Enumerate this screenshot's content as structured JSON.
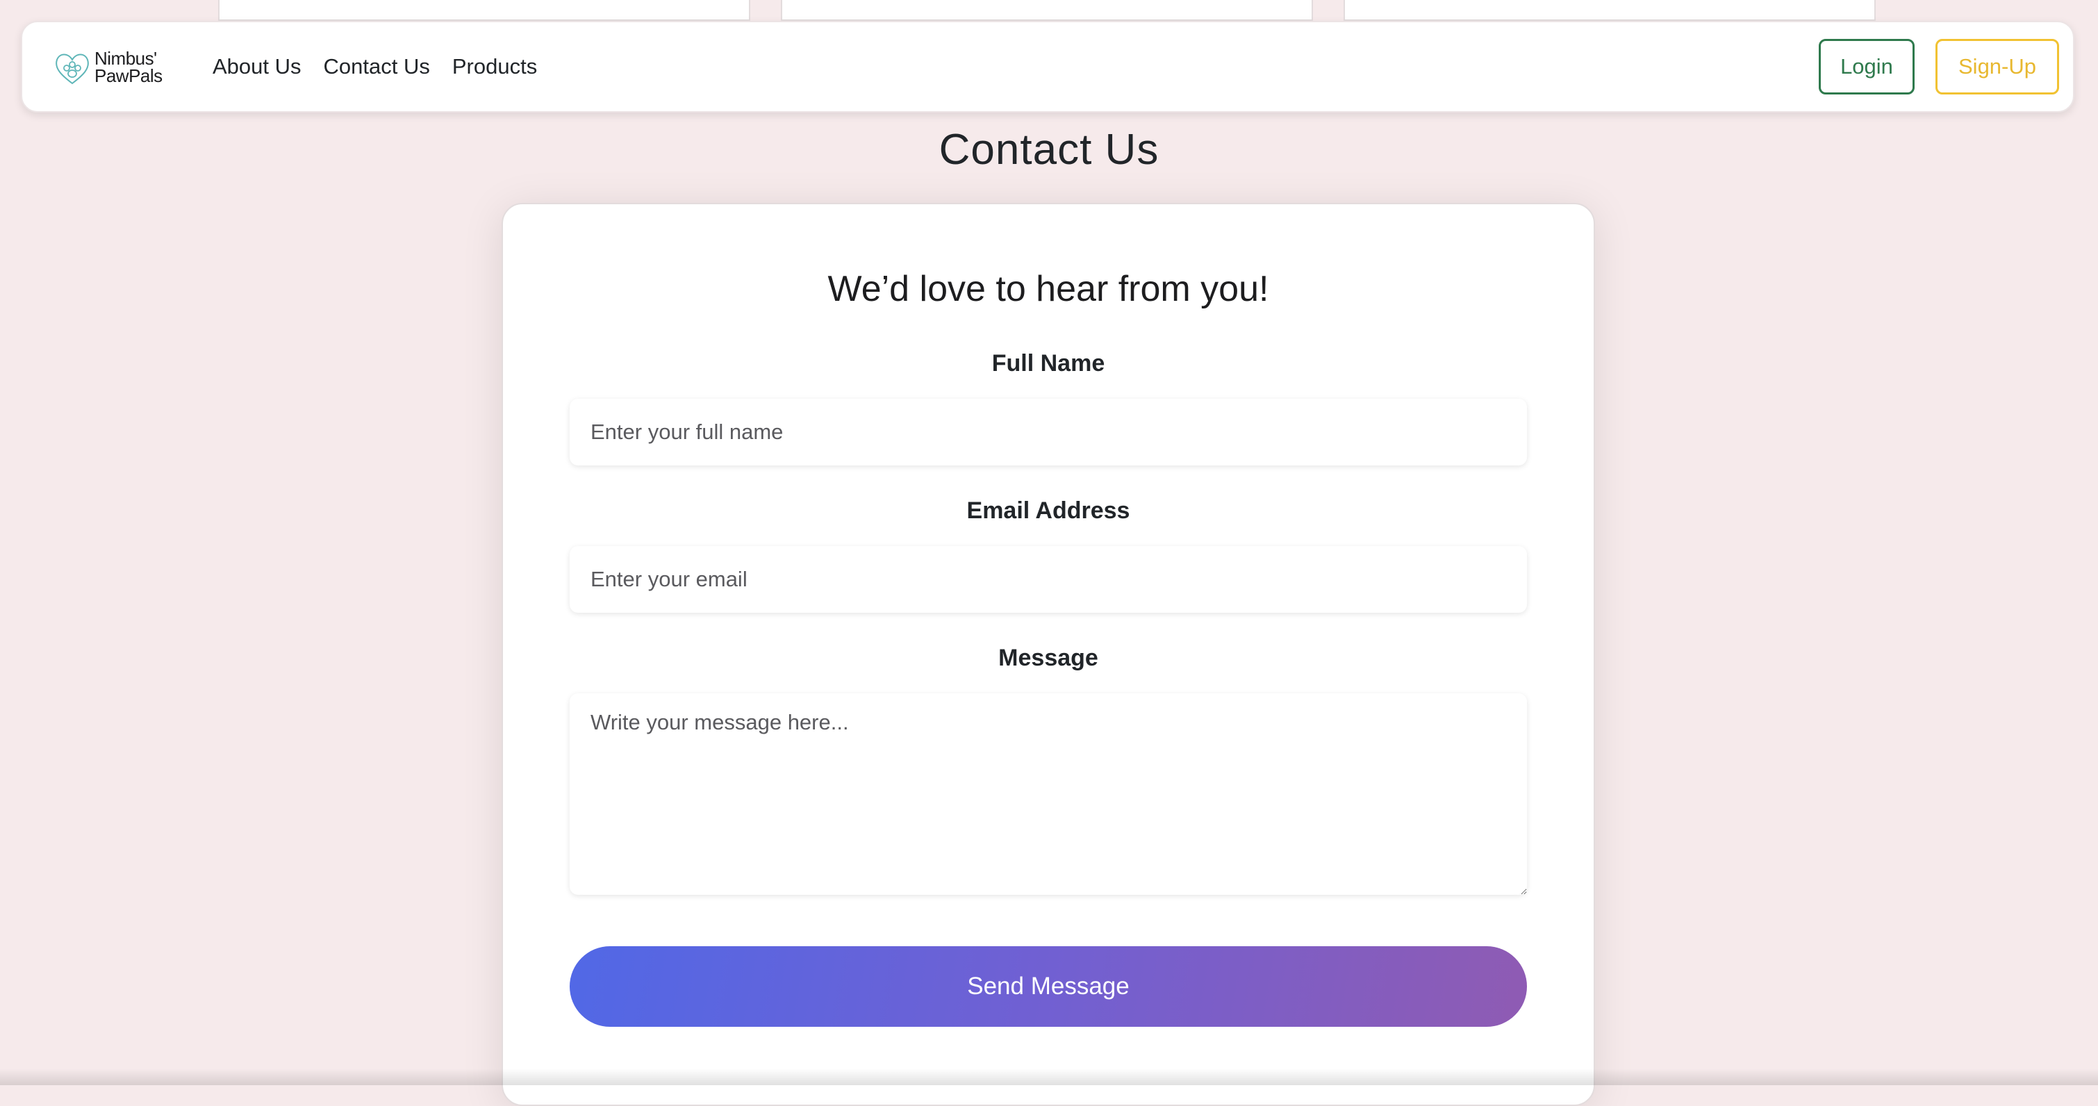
{
  "navbar": {
    "brand": {
      "line1": "Nimbus'",
      "line2": "PawPals",
      "icon": "paw-heart-logo-icon"
    },
    "links": [
      {
        "label": "About Us"
      },
      {
        "label": "Contact Us"
      },
      {
        "label": "Products"
      }
    ],
    "login_label": "Login",
    "signup_label": "Sign-Up"
  },
  "page": {
    "title": "Contact Us"
  },
  "form": {
    "heading": "We’d love to hear from you!",
    "full_name": {
      "label": "Full Name",
      "placeholder": "Enter your full name",
      "value": ""
    },
    "email": {
      "label": "Email Address",
      "placeholder": "Enter your email",
      "value": ""
    },
    "message": {
      "label": "Message",
      "placeholder": "Write your message here...",
      "value": ""
    },
    "submit_label": "Send Message"
  },
  "colors": {
    "page_background": "#f6eaeb",
    "login_accent": "#2f7a4d",
    "signup_accent": "#f1c232",
    "button_gradient_start": "#5168e6",
    "button_gradient_end": "#8f5bb3"
  }
}
